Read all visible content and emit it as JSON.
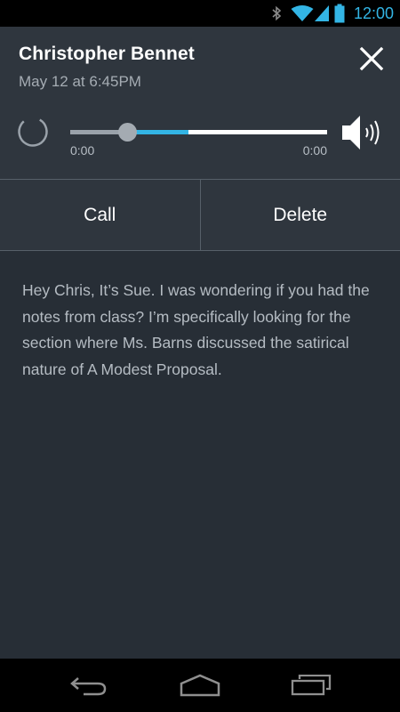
{
  "status_bar": {
    "time": "12:00",
    "icons": [
      "bluetooth-icon",
      "wifi-icon",
      "cell-signal-icon",
      "battery-icon"
    ],
    "accent_color": "#33b5e5"
  },
  "header": {
    "contact_name": "Christopher Bennet",
    "timestamp": "May 12 at 6:45PM",
    "close_icon": "close-icon"
  },
  "player": {
    "elapsed": "0:00",
    "duration": "0:00",
    "played_fraction": 0.22,
    "buffered_fraction": 0.46,
    "status_icon": "loading-spinner-icon",
    "volume_icon": "speaker-icon"
  },
  "actions": {
    "call_label": "Call",
    "delete_label": "Delete"
  },
  "message": {
    "transcript": "Hey Chris, It’s Sue. I was wondering if you had the notes from class? I’m specifically looking for the section where Ms. Barns discussed the satirical nature of A Modest Proposal."
  },
  "nav_bar": {
    "icons": [
      "back-icon",
      "home-icon",
      "recent-apps-icon"
    ]
  },
  "colors": {
    "background": "#272e36",
    "header_background": "#2f363e",
    "accent": "#33b5e5"
  }
}
